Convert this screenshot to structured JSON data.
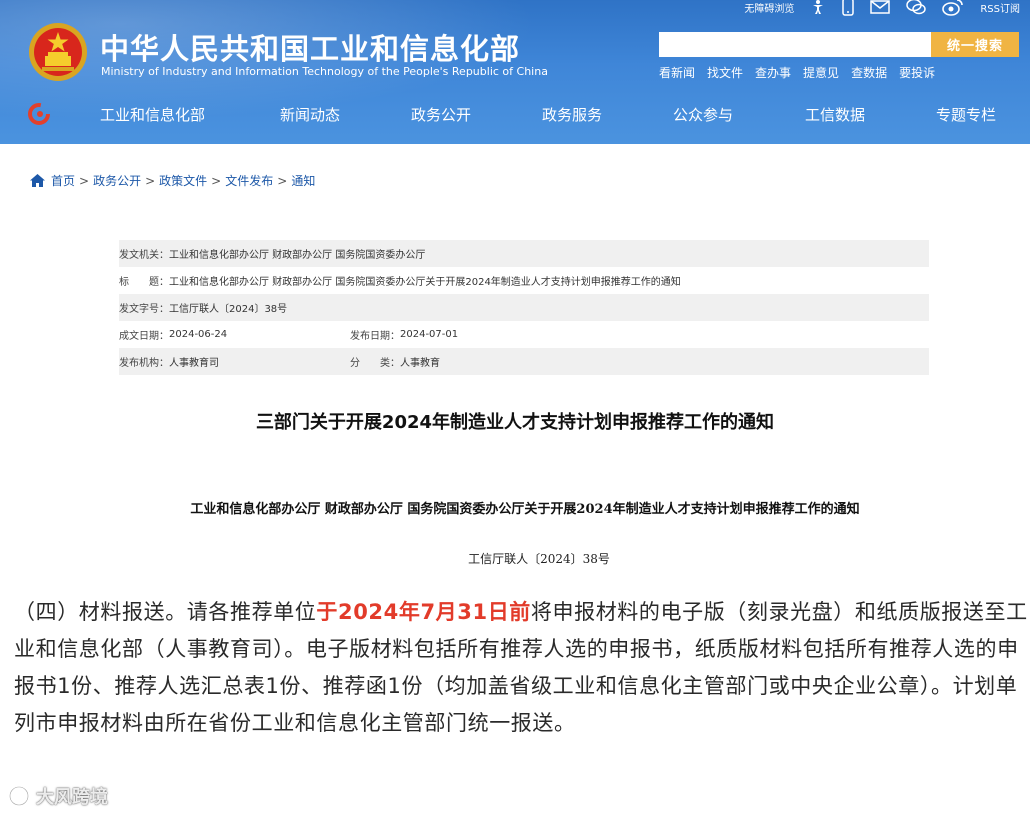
{
  "header": {
    "title": "中华人民共和国工业和信息化部",
    "subtitle": "Ministry of Industry and Information Technology of the People's Republic of China",
    "top_links": {
      "accessibility": "无障碍浏览",
      "rss": "RSS订阅"
    },
    "top_icons": [
      "accessibility-icon",
      "mobile-icon",
      "email-icon",
      "wechat-icon",
      "weibo-icon",
      "rss-icon"
    ],
    "search": {
      "value": "",
      "button_label": "统一搜索"
    },
    "quick_links": [
      "看新闻",
      "找文件",
      "查办事",
      "提意见",
      "查数据",
      "要投诉"
    ]
  },
  "nav": [
    "工业和信息化部",
    "新闻动态",
    "政务公开",
    "政务服务",
    "公众参与",
    "工信数据",
    "专题专栏"
  ],
  "breadcrumb": [
    "首页",
    "政务公开",
    "政策文件",
    "文件发布",
    "通知"
  ],
  "info": {
    "issuer_label": "发文机关：",
    "issuer": "工业和信息化部办公厅 财政部办公厅 国务院国资委办公厅",
    "title_label": "标　　题：",
    "title": "工业和信息化部办公厅 财政部办公厅 国务院国资委办公厅关于开展2024年制造业人才支持计划申报推荐工作的通知",
    "doc_no_label": "发文字号：",
    "doc_no": "工信厅联人〔2024〕38号",
    "created_label": "成文日期：",
    "created": "2024-06-24",
    "published_label": "发布日期：",
    "published": "2024-07-01",
    "org_label": "发布机构：",
    "org": "人事教育司",
    "category_label": "分　　类：",
    "category": "人事教育"
  },
  "document": {
    "title": "三部门关于开展2024年制造业人才支持计划申报推荐工作的通知",
    "heading": "工业和信息化部办公厅  财政部办公厅  国务院国资委办公厅关于开展2024年制造业人才支持计划申报推荐工作的通知",
    "number": "工信厅联人〔2024〕38号",
    "paragraph_before": "（四）材料报送。请各推荐单位",
    "paragraph_highlight": "于2024年7月31日前",
    "paragraph_after": "将申报材料的电子版（刻录光盘）和纸质版报送至工业和信息化部（人事教育司）。电子版材料包括所有推荐人选的申报书，纸质版材料包括所有推荐人选的申报书1份、推荐人选汇总表1份、推荐函1份（均加盖省级工业和信息化主管部门或中央企业公章）。计划单列市申报材料由所在省份工业和信息化主管部门统一报送。"
  },
  "colors": {
    "header_blue": "#3f86d8",
    "search_button": "#f0b443",
    "highlight_red": "#e23b2a",
    "link_blue": "#1d58a8"
  },
  "watermark": "大风跨境"
}
